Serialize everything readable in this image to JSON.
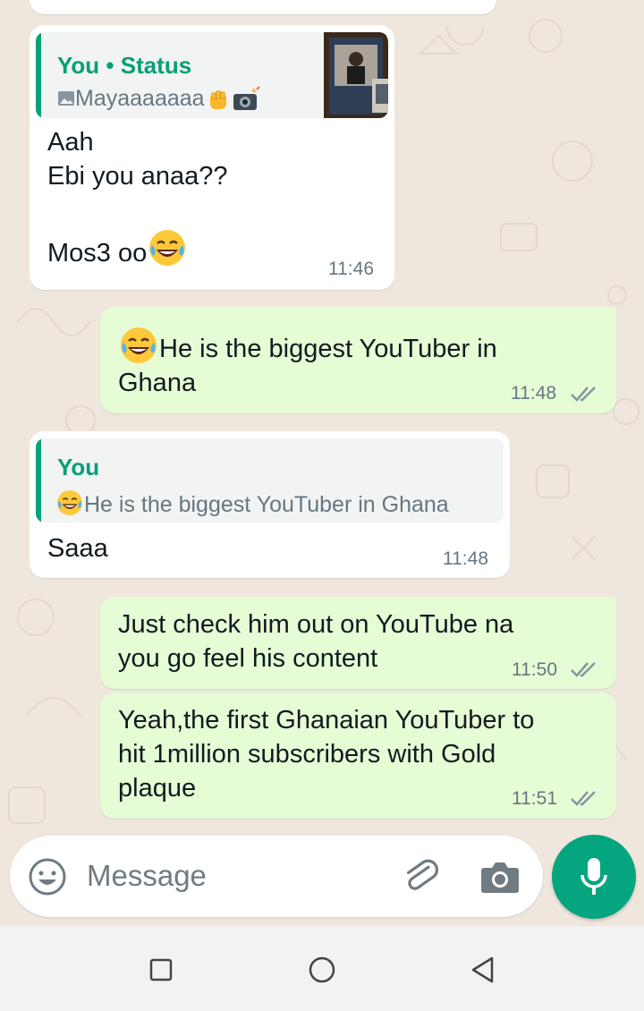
{
  "chat": {
    "messages": [
      {
        "direction": "incoming",
        "quote": {
          "name": "You • Status",
          "text": "Mayaaaaaaa",
          "media": "photo-icon",
          "emojis": [
            "raised-fist-emoji",
            "camera-flash-emoji"
          ]
        },
        "text": "Aah\nEbi you anaa??\n\nMos3 oo",
        "trailing_emoji": "tears-of-joy-emoji",
        "time": "11:46"
      },
      {
        "direction": "outgoing",
        "leading_emoji": "tears-of-joy-emoji",
        "line1": "He is the biggest YouTuber in",
        "line2": "Ghana",
        "time": "11:48",
        "status": "read"
      },
      {
        "direction": "incoming",
        "quote": {
          "name": "You",
          "text": "He is the biggest YouTuber in Ghana",
          "leading_emoji": "tears-of-joy-emoji"
        },
        "text": "Saaa",
        "time": "11:48"
      },
      {
        "direction": "outgoing",
        "text": "Just check him out on YouTube na\nyou go feel his content",
        "time": "11:50",
        "status": "read"
      },
      {
        "direction": "outgoing",
        "text": "Yeah,the first Ghanaian YouTuber to\nhit 1million subscribers with Gold\nplaque",
        "time": "11:51",
        "status": "read"
      }
    ]
  },
  "composer": {
    "placeholder": "Message",
    "icons": [
      "emoji-icon",
      "attach-icon",
      "camera-icon",
      "mic-icon"
    ],
    "accent": "#04a57f"
  },
  "navbar": {
    "buttons": [
      "recents-button",
      "home-button",
      "back-button"
    ]
  },
  "colors": {
    "outgoing_bubble": "#e6fcd5",
    "quote_accent": "#06a37a",
    "background": "#efe7de"
  }
}
